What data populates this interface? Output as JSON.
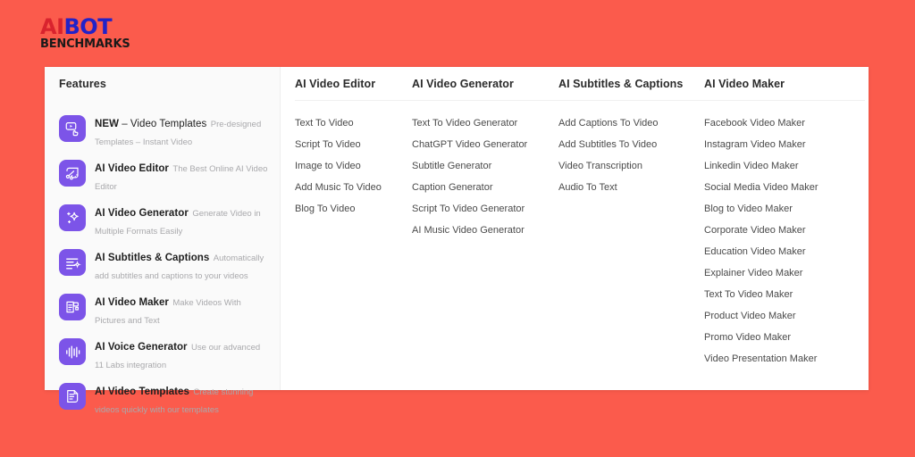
{
  "theme": {
    "page_bg": "#fb5b4c",
    "panel_bg": "#ffffff",
    "sidebar_bg": "#fafafa",
    "accent_purple": "#7c54e8",
    "heading_color": "#2b2b2b",
    "link_color": "#4a4a4a",
    "muted_color": "#a9a9ac"
  },
  "logo": {
    "part_ai": "AI",
    "part_bot": "BOT",
    "part_benchmarks": "BENCHMARKS",
    "color_ai": "#d9232e",
    "color_bot": "#2222c8",
    "color_benchmarks": "#1a1a1a"
  },
  "sidebar": {
    "header": "Features",
    "items": [
      {
        "label_bold": "NEW",
        "label_rest": " – Video Templates",
        "desc": "Pre-designed Templates – Instant Video",
        "icon": "video-thumbsup-icon"
      },
      {
        "label_bold": "AI Video Editor",
        "label_rest": "",
        "desc": "The Best Online AI Video Editor",
        "icon": "scissors-cut-icon"
      },
      {
        "label_bold": "AI Video Generator",
        "label_rest": "",
        "desc": "Generate Video in Multiple Formats Easily",
        "icon": "sparkle-star-icon"
      },
      {
        "label_bold": "AI Subtitles & Captions",
        "label_rest": "",
        "desc": "Automatically add subtitles and captions to your videos",
        "icon": "subtitle-lines-sparkle-icon"
      },
      {
        "label_bold": "AI Video Maker",
        "label_rest": "",
        "desc": "Make Videos With Pictures and Text",
        "icon": "document-video-icon"
      },
      {
        "label_bold": "AI Voice Generator",
        "label_rest": "",
        "desc": "Use our advanced 11 Labs integration",
        "icon": "audio-waveform-icon"
      },
      {
        "label_bold": "AI Video Templates",
        "label_rest": "",
        "desc": "Create stunning videos quickly with our templates",
        "icon": "document-template-icon"
      }
    ]
  },
  "columns": [
    {
      "heading": "AI Video Editor",
      "links": [
        "Text To Video",
        "Script To Video",
        "Image to Video",
        "Add Music To Video",
        "Blog To Video"
      ]
    },
    {
      "heading": "AI Video Generator",
      "links": [
        "Text To Video Generator",
        "ChatGPT Video Generator",
        "Subtitle Generator",
        "Caption Generator",
        "Script To Video Generator",
        "AI Music Video Generator"
      ]
    },
    {
      "heading": "AI Subtitles & Captions",
      "links": [
        "Add Captions To Video",
        "Add Subtitles To Video",
        "Video Transcription",
        "Audio To Text"
      ]
    },
    {
      "heading": "AI Video Maker",
      "links": [
        "Facebook Video Maker",
        "Instagram Video Maker",
        "Linkedin Video Maker",
        "Social Media Video Maker",
        "Blog to Video Maker",
        "Corporate Video Maker",
        "Education Video Maker",
        "Explainer Video Maker",
        "Text To Video Maker",
        "Product Video Maker",
        "Promo Video Maker",
        "Video Presentation Maker"
      ]
    }
  ]
}
